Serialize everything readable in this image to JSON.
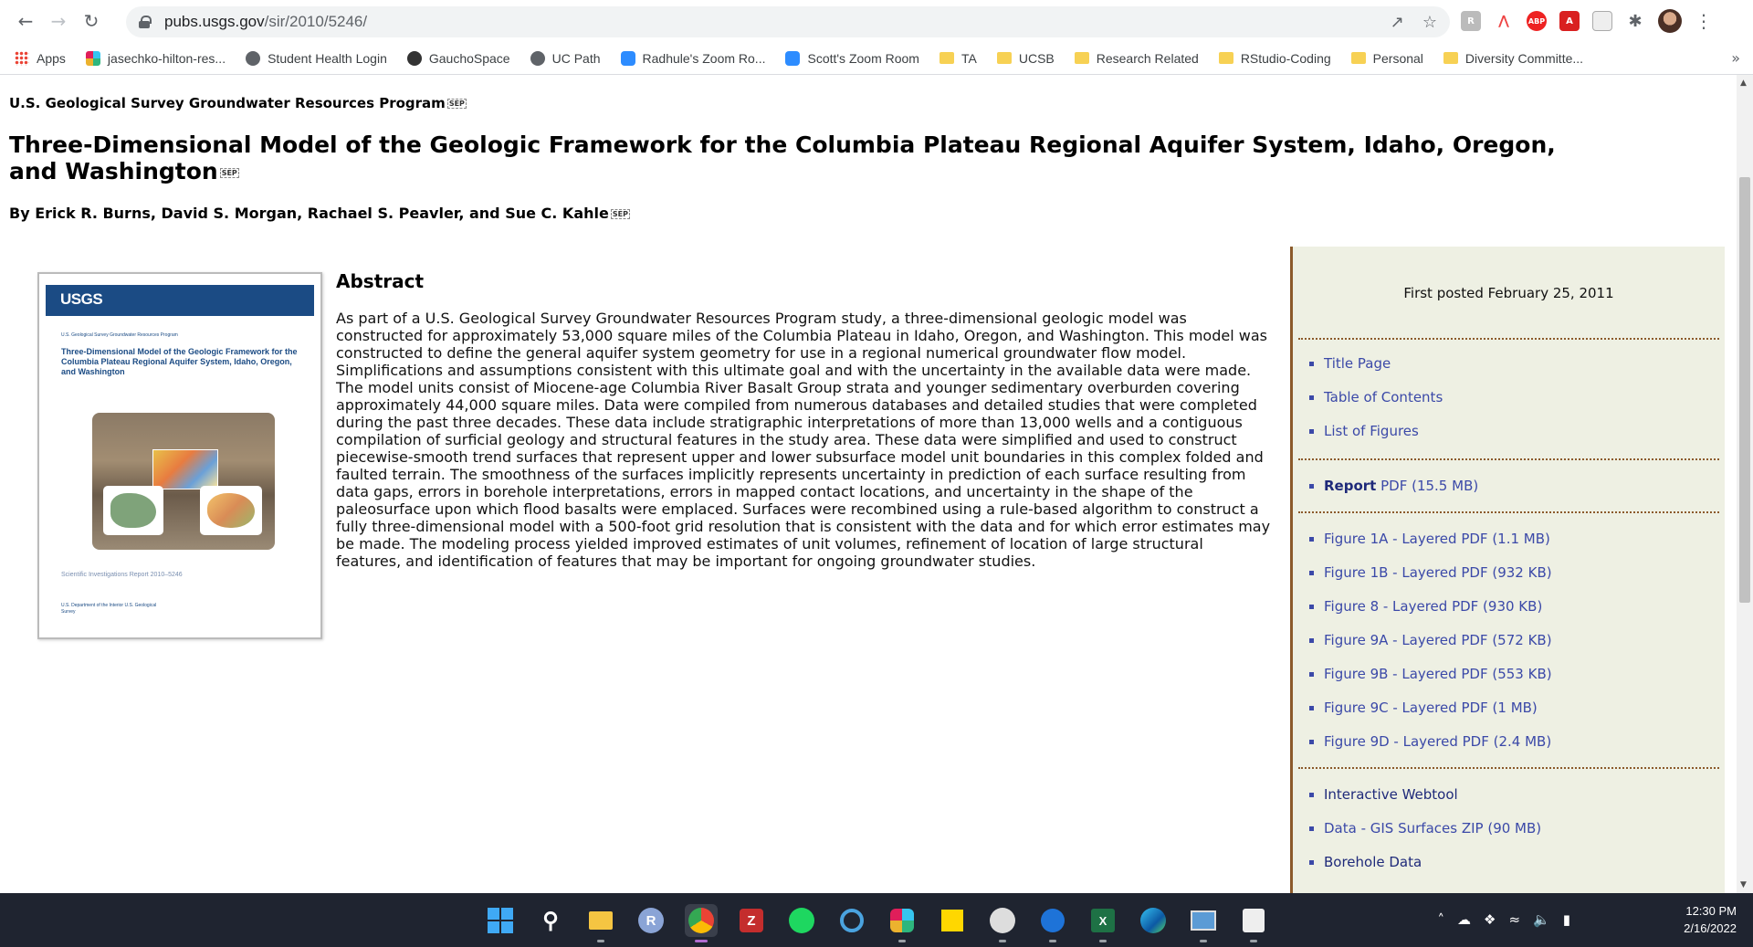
{
  "browser": {
    "url_host": "pubs.usgs.gov",
    "url_path": "/sir/2010/5246/",
    "bookmarks": [
      {
        "label": "Apps",
        "icon": "apps-icon"
      },
      {
        "label": "jasechko-hilton-res...",
        "icon": "slack-icon"
      },
      {
        "label": "Student Health Login",
        "icon": "globe-icon"
      },
      {
        "label": "GauchoSpace",
        "icon": "gauchospace-icon"
      },
      {
        "label": "UC Path",
        "icon": "globe-icon"
      },
      {
        "label": "Radhule's Zoom Ro...",
        "icon": "zoom-icon"
      },
      {
        "label": "Scott's Zoom Room",
        "icon": "zoom-icon"
      },
      {
        "label": "TA",
        "icon": "folder-icon"
      },
      {
        "label": "UCSB",
        "icon": "folder-icon"
      },
      {
        "label": "Research Related",
        "icon": "folder-icon"
      },
      {
        "label": "RStudio-Coding",
        "icon": "folder-icon"
      },
      {
        "label": "Personal",
        "icon": "folder-icon"
      },
      {
        "label": "Diversity Committe...",
        "icon": "folder-icon"
      }
    ]
  },
  "page": {
    "program": "U.S. Geological Survey Groundwater Resources Program",
    "title": "Three-Dimensional Model of the Geologic Framework for the Columbia Plateau Regional Aquifer System, Idaho, Oregon, and Washington",
    "authors": "By Erick R. Burns, David S. Morgan, Rachael S. Peavler, and Sue C. Kahle",
    "marker": "SEP",
    "cover": {
      "logo": "USGS",
      "program": "U.S. Geological Survey Groundwater Resources Program",
      "title": "Three-Dimensional Model of the Geologic Framework for the Columbia Plateau Regional Aquifer System, Idaho, Oregon, and Washington",
      "series": "Scientific Investigations Report 2010–5246",
      "dept": "U.S. Department of the Interior U.S. Geological Survey"
    },
    "abstract_heading": "Abstract",
    "abstract": "As part of a U.S. Geological Survey Groundwater Resources Program study, a three-dimensional geologic model was constructed for approximately 53,000 square miles of the Columbia Plateau in Idaho, Oregon, and Washington. This model was constructed to define the general aquifer system geometry for use in a regional numerical groundwater flow model. Simplifications and assumptions consistent with this ultimate goal and with the uncertainty in the available data were made. The model units consist of Miocene-age Columbia River Basalt Group strata and younger sedimentary overburden covering approximately 44,000 square miles. Data were compiled from numerous databases and detailed studies that were completed during the past three decades. These data include stratigraphic interpretations of more than 13,000 wells and a contiguous compilation of surficial geology and structural features in the study area. These data were simplified and used to construct piecewise-smooth trend surfaces that represent upper and lower subsurface model unit boundaries in this complex folded and faulted terrain. The smoothness of the surfaces implicitly represents uncertainty in prediction of each surface resulting from data gaps, errors in borehole interpretations, errors in mapped contact locations, and uncertainty in the shape of the paleosurface upon which flood basalts were emplaced. Surfaces were recombined using a rule-based algorithm to construct a fully three-dimensional model with a 500-foot grid resolution that is consistent with the data and for which error estimates may be made. The modeling process yielded improved estimates of unit volumes, refinement of location of large structural features, and identification of features that may be important for ongoing groundwater studies."
  },
  "sidebar": {
    "posted": "First posted February 25, 2011",
    "group1": [
      "Title Page",
      "Table of Contents",
      "List of Figures"
    ],
    "report_strong": "Report",
    "report_rest": " PDF (15.5 MB)",
    "figures": [
      "Figure 1A - Layered PDF (1.1 MB)",
      "Figure 1B - Layered PDF (932 KB)",
      "Figure 8 - Layered PDF (930 KB)",
      "Figure 9A - Layered PDF (572 KB)",
      "Figure 9B - Layered PDF (553 KB)",
      "Figure 9C - Layered PDF (1 MB)",
      "Figure 9D - Layered PDF (2.4 MB)"
    ],
    "group4": [
      "Interactive Webtool",
      "Data - GIS Surfaces ZIP (90 MB)",
      "Borehole Data"
    ]
  },
  "taskbar": {
    "time": "12:30 PM",
    "date": "2/16/2022"
  }
}
